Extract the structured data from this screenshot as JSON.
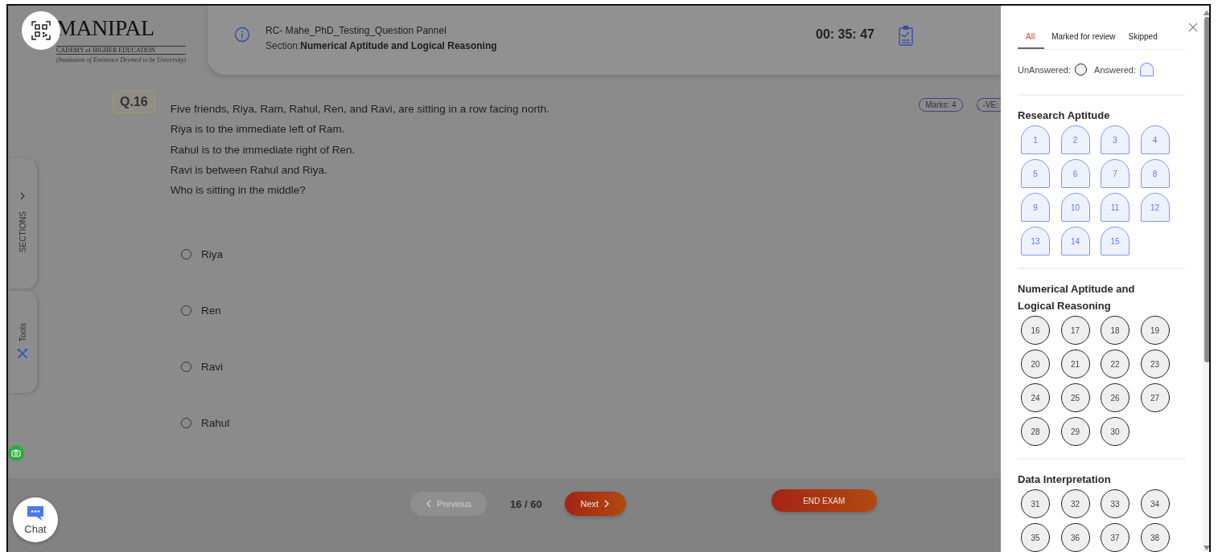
{
  "header": {
    "logo": {
      "name": "MANIPAL",
      "subtitle": "CADEMY of HIGHER EDUCATION",
      "tagline": "(Institution of Eminence Deemed to be University)"
    },
    "title": "RC- Mahe_PhD_Testing_Question Pannel",
    "section_label": "Section:",
    "section_name": "Numerical Aptitude and Logical Reasoning",
    "timer": "00: 35: 47"
  },
  "side_tabs": [
    {
      "kind": "sections",
      "label": "SECTIONS"
    },
    {
      "kind": "tools",
      "label": "Tools"
    }
  ],
  "question": {
    "number": "Q.16",
    "marks": "Marks: 4",
    "negative": "-VE:",
    "lines": [
      "Five friends, Riya, Ram, Rahul, Ren, and Ravi, are sitting in a row facing north.",
      "Riya is to the immediate left of Ram.",
      "Rahul is to the immediate right of Ren.",
      "Ravi is between Rahul and Riya.",
      "Who is sitting in the middle?"
    ],
    "options": [
      {
        "label": "Riya",
        "selected": false
      },
      {
        "label": "Ren",
        "selected": false
      },
      {
        "label": "Ravi",
        "selected": false
      },
      {
        "label": "Rahul",
        "selected": false
      }
    ]
  },
  "navigation": {
    "previous": {
      "label": "Previous",
      "disabled": true
    },
    "counter": "16 / 60",
    "next": {
      "label": "Next",
      "disabled": false
    },
    "end_exam": "END EXAM"
  },
  "chat": {
    "label": "Chat"
  },
  "palette": {
    "tabs": [
      {
        "label": "All",
        "selected": true
      },
      {
        "label": "Marked for review",
        "selected": false
      },
      {
        "label": "Skipped",
        "selected": false
      }
    ],
    "legend": [
      {
        "label": "UnAnswered:",
        "kind": "unanswered"
      },
      {
        "label": "Answered:",
        "kind": "answered"
      }
    ],
    "sections": [
      {
        "title": "Research Aptitude",
        "questions": [
          {
            "number": "1",
            "answered": true
          },
          {
            "number": "2",
            "answered": true
          },
          {
            "number": "3",
            "answered": true
          },
          {
            "number": "4",
            "answered": true
          },
          {
            "number": "5",
            "answered": true
          },
          {
            "number": "6",
            "answered": true
          },
          {
            "number": "7",
            "answered": true
          },
          {
            "number": "8",
            "answered": true
          },
          {
            "number": "9",
            "answered": true
          },
          {
            "number": "10",
            "answered": true
          },
          {
            "number": "11",
            "answered": true
          },
          {
            "number": "12",
            "answered": true
          },
          {
            "number": "13",
            "answered": true
          },
          {
            "number": "14",
            "answered": true
          },
          {
            "number": "15",
            "answered": true
          }
        ]
      },
      {
        "title": "Numerical Aptitude and Logical Reasoning",
        "questions": [
          {
            "number": "16",
            "answered": false
          },
          {
            "number": "17",
            "answered": false
          },
          {
            "number": "18",
            "answered": false
          },
          {
            "number": "19",
            "answered": false
          },
          {
            "number": "20",
            "answered": false
          },
          {
            "number": "21",
            "answered": false
          },
          {
            "number": "22",
            "answered": false
          },
          {
            "number": "23",
            "answered": false
          },
          {
            "number": "24",
            "answered": false
          },
          {
            "number": "25",
            "answered": false
          },
          {
            "number": "26",
            "answered": false
          },
          {
            "number": "27",
            "answered": false
          },
          {
            "number": "28",
            "answered": false
          },
          {
            "number": "29",
            "answered": false
          },
          {
            "number": "30",
            "answered": false
          }
        ]
      },
      {
        "title": "Data Interpretation",
        "questions": [
          {
            "number": "31",
            "answered": false
          },
          {
            "number": "32",
            "answered": false
          },
          {
            "number": "33",
            "answered": false
          },
          {
            "number": "34",
            "answered": false
          },
          {
            "number": "35",
            "answered": false
          },
          {
            "number": "36",
            "answered": false
          },
          {
            "number": "37",
            "answered": false
          },
          {
            "number": "38",
            "answered": false
          }
        ]
      }
    ]
  }
}
